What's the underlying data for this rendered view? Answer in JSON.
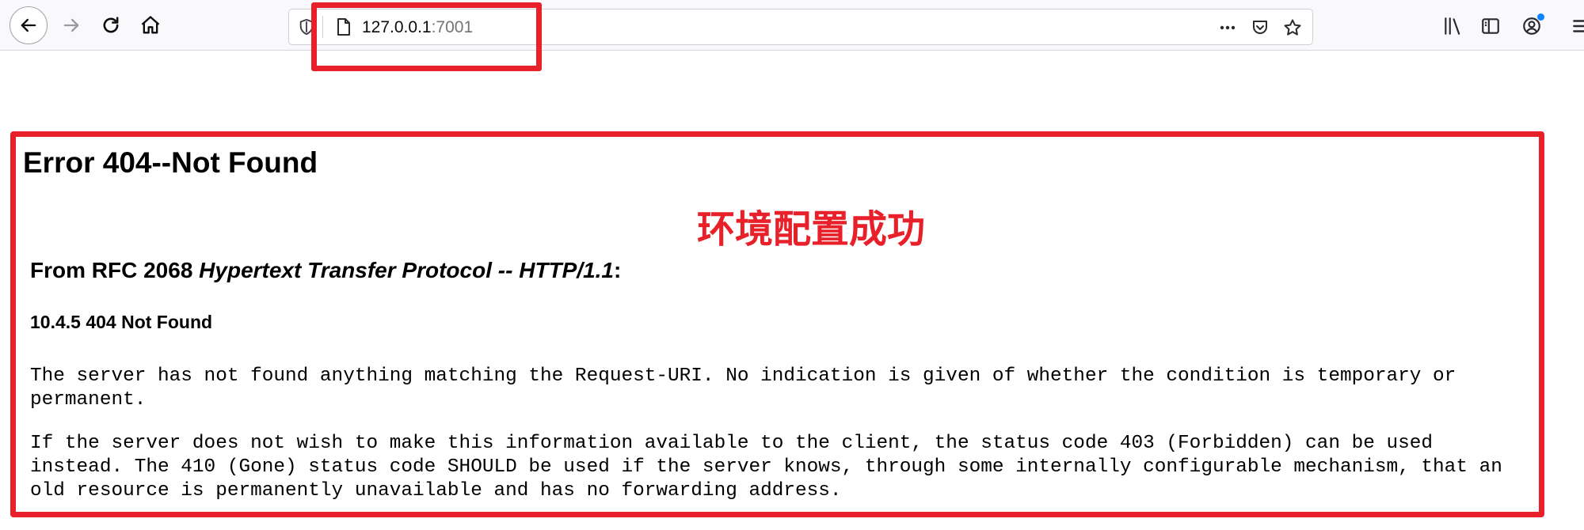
{
  "browser": {
    "url_host": "127.0.0.1",
    "url_port": ":7001",
    "icons": {
      "back": "arrow-left-icon",
      "forward": "arrow-right-icon",
      "reload": "reload-icon",
      "home": "home-icon",
      "tracking": "shield-icon",
      "page": "page-icon",
      "more": "more-dots-icon",
      "pocket": "pocket-icon",
      "bookmark": "star-icon",
      "library": "library-icon",
      "sidebar": "sidebar-icon",
      "account": "account-icon",
      "menu": "hamburger-menu-icon"
    }
  },
  "page": {
    "title": "Error 404--Not Found",
    "rfc_heading_prefix": "From RFC 2068 ",
    "rfc_heading_title": "Hypertext Transfer Protocol -- HTTP/1.1",
    "rfc_heading_suffix": ":",
    "section_heading": "10.4.5 404 Not Found",
    "para1_lines": [
      "The server has not found anything matching the Request-URI. No indication is given of whether the condition is temporary or",
      "permanent."
    ],
    "para2_lines": [
      "If the server does not wish to make this information available to the client, the status code 403 (Forbidden) can be used",
      "instead. The 410 (Gone) status code SHOULD be used if the server knows, through some internally configurable mechanism, that an",
      "old resource is permanently unavailable and has no forwarding address."
    ]
  },
  "annotation": {
    "note": "环境配置成功",
    "color": "#e8202a"
  }
}
